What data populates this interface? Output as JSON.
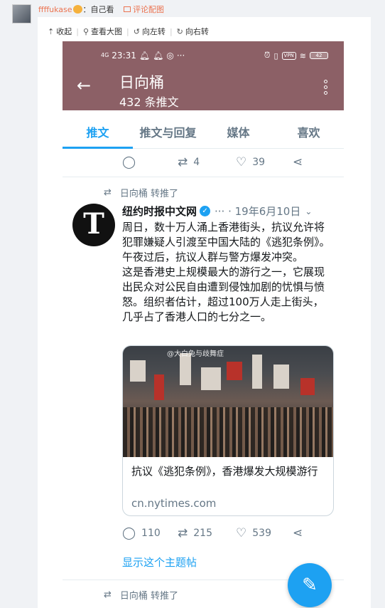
{
  "comment": {
    "username": "ffffukase",
    "suffix": "：自己看",
    "pic_link": "评论配图"
  },
  "toolbar": {
    "collapse": "收起",
    "view_large": "查看大图",
    "rotate_left": "向左转",
    "rotate_right": "向右转"
  },
  "status_bar": {
    "signal": "4G",
    "time": "23:31",
    "dots": "···",
    "vpn": "VPN",
    "battery": "42"
  },
  "profile_header": {
    "name": "日向桶",
    "tweet_count": "432 条推文"
  },
  "tabs": [
    {
      "label": "推文",
      "active": true
    },
    {
      "label": "推文与回复",
      "active": false
    },
    {
      "label": "媒体",
      "active": false
    },
    {
      "label": "喜欢",
      "active": false
    }
  ],
  "prev_tweet_actions": {
    "retweets": "4",
    "likes": "39"
  },
  "retweet_indicator": "日向桶 转推了",
  "tweet": {
    "author": "纽约时报中文网",
    "avatar_letter": "T",
    "meta": "··· · 19年6月10日",
    "body": [
      "周日，数十万人涌上香港街头，抗议允许将犯罪嫌疑人引渡至中国大陆的《逃犯条例》。午夜过后，抗议人群与警方爆发冲突。",
      "这是香港史上规模最大的游行之一，它展现出民众对公民自由遭到侵蚀加剧的忧惧与愤怒。组织者估计，超过100万人走上街头，几乎占了香港人口的七分之一。"
    ],
    "card": {
      "watermark": "@大白兔与歧舞症",
      "title": "抗议《逃犯条例》，香港爆发大规模游行",
      "domain": "cn.nytimes.com"
    },
    "actions": {
      "replies": "110",
      "retweets": "215",
      "likes": "539"
    },
    "show_thread": "显示这个主题帖"
  },
  "next_retweet_indicator": "日向桶 转推了",
  "colors": {
    "header_bg": "#8c6066",
    "accent": "#1da1f2",
    "weibo_orange": "#eb7350"
  }
}
